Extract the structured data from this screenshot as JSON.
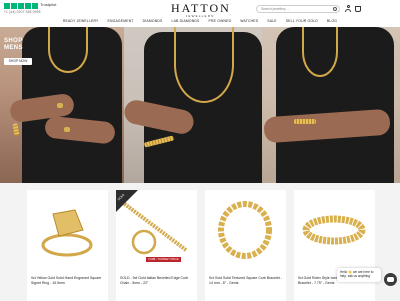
{
  "header": {
    "trustpilot_label": "Trustpilot",
    "tagline": "+1 (44) 0207 355 0999",
    "logo_name": "HATTON",
    "logo_tagline": "JEWELLERS",
    "search_placeholder": "Search jewellery ..."
  },
  "nav": {
    "items": [
      "READY JEWELLERY",
      "ENGAGEMENT",
      "DIAMONDS",
      "LAB DIAMONDS",
      "PRE OWNED",
      "WATCHES",
      "SALE",
      "SELL YOUR GOLD",
      "BLOG"
    ]
  },
  "hero": {
    "shop_line1": "SHOP",
    "shop_line2": "MENS",
    "shop_button": "SHOP NOW",
    "accent": "#d3a84a"
  },
  "products": [
    {
      "title": "9ct Yellow Gold Solid Hand Engraved Square Signet Ring - 15.5mm",
      "sold": false
    },
    {
      "title": "SOLD - 9ct Gold Italian Bevelled Edge Curb Chain - 5mm - 22\"",
      "sold": true,
      "sold_label": "SOLD",
      "sale_label": "CURB - TURNKEY PRICE"
    },
    {
      "title": "9ct Gold Solid Textured Square Curb Bracelet - 14 mm - 8\" - Gents",
      "sold": false
    },
    {
      "title": "9ct Gold Rolex Style Iced Out Presidential Bracelet - 7.75\" - Gents",
      "sold": false
    }
  ],
  "chat": {
    "message": "Hello 👋 we are here to help, ask us anything"
  }
}
